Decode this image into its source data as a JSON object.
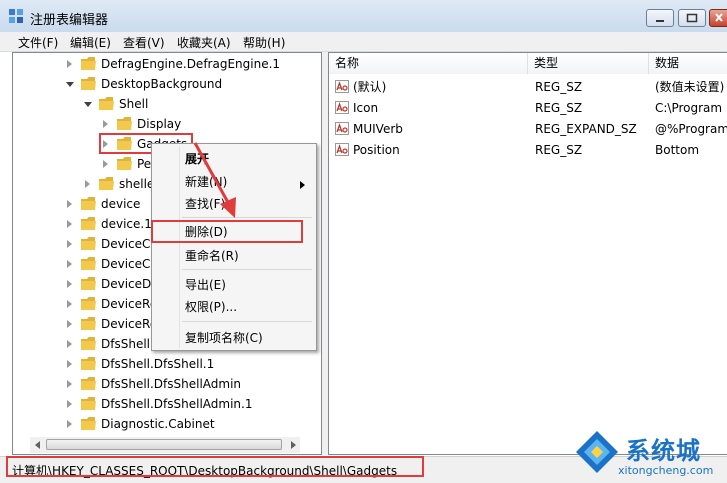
{
  "window": {
    "title": "注册表编辑器"
  },
  "menu": [
    "文件(F)",
    "编辑(E)",
    "查看(V)",
    "收藏夹(A)",
    "帮助(H)"
  ],
  "tree": {
    "items": [
      {
        "label": "DefragEngine.DefragEngine.1",
        "level": 2,
        "expander": "collapsed"
      },
      {
        "label": "DesktopBackground",
        "level": 2,
        "expander": "expanded"
      },
      {
        "label": "Shell",
        "level": 3,
        "expander": "expanded"
      },
      {
        "label": "Display",
        "level": 4,
        "expander": "collapsed"
      },
      {
        "label": "Gadgets",
        "level": 4,
        "expander": "collapsed",
        "selected": true
      },
      {
        "label": "Per",
        "level": 4,
        "expander": "collapsed"
      },
      {
        "label": "shellex",
        "level": 3,
        "expander": "collapsed"
      },
      {
        "label": "device",
        "level": 2,
        "expander": "collapsed"
      },
      {
        "label": "device.1",
        "level": 2,
        "expander": "collapsed"
      },
      {
        "label": "DeviceCer",
        "level": 2,
        "expander": "collapsed"
      },
      {
        "label": "DeviceCer",
        "level": 2,
        "expander": "collapsed"
      },
      {
        "label": "DeviceDis",
        "level": 2,
        "expander": "collapsed"
      },
      {
        "label": "DeviceRec",
        "level": 2,
        "expander": "collapsed"
      },
      {
        "label": "DeviceRec",
        "level": 2,
        "expander": "collapsed"
      },
      {
        "label": "DfsShell.D",
        "level": 2,
        "expander": "collapsed"
      },
      {
        "label": "DfsShell.DfsShell.1",
        "level": 2,
        "expander": "collapsed"
      },
      {
        "label": "DfsShell.DfsShellAdmin",
        "level": 2,
        "expander": "collapsed"
      },
      {
        "label": "DfsShell.DfsShellAdmin.1",
        "level": 2,
        "expander": "collapsed"
      },
      {
        "label": "Diagnostic.Cabinet",
        "level": 2,
        "expander": "collapsed"
      }
    ]
  },
  "list": {
    "columns": [
      "名称",
      "类型",
      "数据"
    ],
    "rows": [
      {
        "name": "(默认)",
        "type": "REG_SZ",
        "data": "(数值未设置)"
      },
      {
        "name": "Icon",
        "type": "REG_SZ",
        "data": "C:\\Program"
      },
      {
        "name": "MUIVerb",
        "type": "REG_EXPAND_SZ",
        "data": "@%Program"
      },
      {
        "name": "Position",
        "type": "REG_SZ",
        "data": "Bottom"
      }
    ]
  },
  "context_menu": {
    "items": [
      {
        "label": "展开",
        "bold": true
      },
      {
        "label": "新建(N)",
        "submenu": true
      },
      {
        "label": "查找(F)..."
      },
      {
        "label": "删除(D)",
        "highlighted": true
      },
      {
        "label": "重命名(R)"
      },
      {
        "label": "导出(E)"
      },
      {
        "label": "权限(P)..."
      },
      {
        "label": "复制项名称(C)"
      }
    ]
  },
  "status": {
    "path": "计算机\\HKEY_CLASSES_ROOT\\DesktopBackground\\Shell\\Gadgets"
  },
  "watermark": {
    "text_cn": "系统城",
    "text_en": "xitongcheng.com"
  },
  "colors": {
    "annotation_red": "#e03c3c",
    "folder_yellow": "#f2c94c",
    "watermark_blue": "#1a73c7"
  }
}
